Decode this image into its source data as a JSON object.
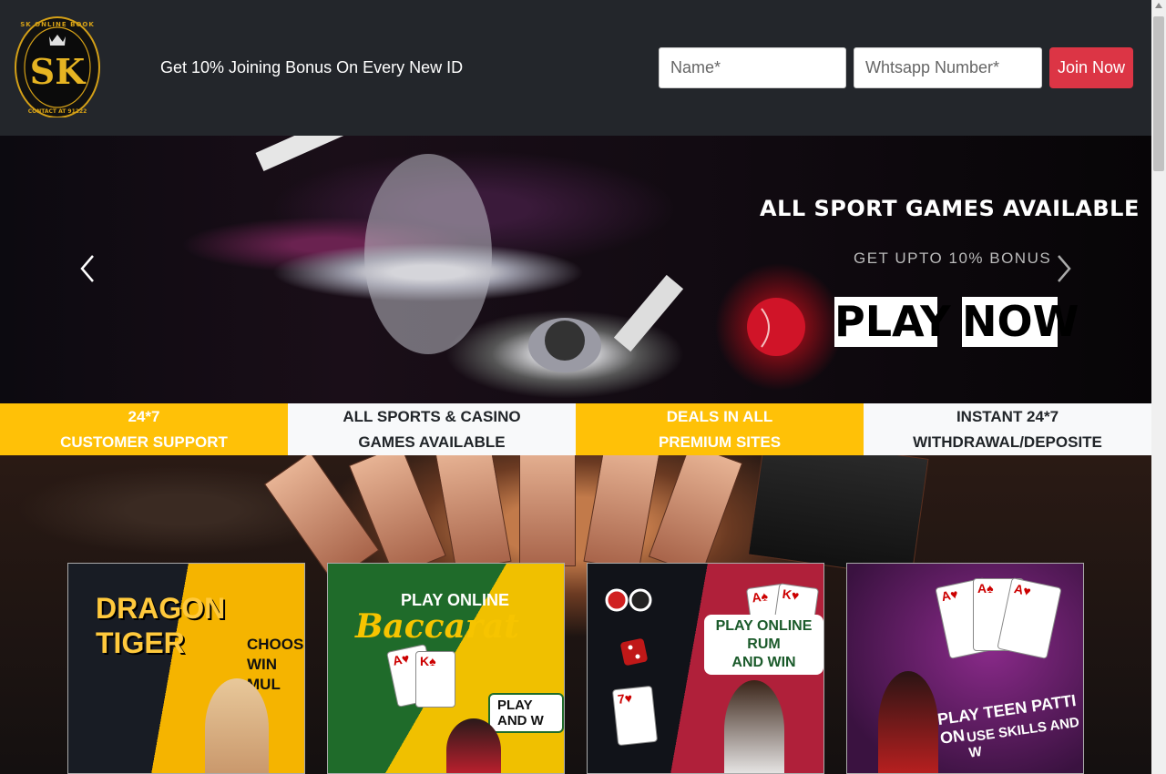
{
  "header": {
    "logo_monogram": "SK",
    "logo_ring_text": "SK ONLINE BOOK · CONTACT AT 91222",
    "tagline": "Get 10% Joining Bonus On Every New ID",
    "name_placeholder": "Name*",
    "whatsapp_placeholder": "Whtsapp Number*",
    "join_label": "Join Now"
  },
  "hero": {
    "title": "ALL SPORT GAMES AVAILABLE",
    "subtitle": "GET UPTO 10% BONUS",
    "play_word": "PLAY",
    "now_word": "NOW",
    "prev_icon": "chevron-left-icon",
    "next_icon": "chevron-right-icon"
  },
  "features": [
    {
      "line1": "24*7",
      "line2": "CUSTOMER SUPPORT",
      "style": "yellow"
    },
    {
      "line1": "ALL SPORTS & CASINO",
      "line2": "GAMES AVAILABLE",
      "style": "light"
    },
    {
      "line1": "DEALS IN ALL",
      "line2": "PREMIUM SITES",
      "style": "yellow"
    },
    {
      "line1": "INSTANT 24*7",
      "line2": "WITHDRAWAL/DEPOSITE",
      "style": "light"
    }
  ],
  "games": [
    {
      "title_1": "DRAGON",
      "title_2": "TIGER",
      "side_1": "CHOOSE",
      "side_2": "WIN MUL"
    },
    {
      "title": "PLAY ONLINE",
      "script": "Baccarat",
      "cta": "PLAY AND W"
    },
    {
      "title_1": "PLAY ONLINE RUM",
      "title_2": "AND WIN"
    },
    {
      "title": "PLAY TEEN PATTI ON",
      "sub": "USE SKILLS AND W"
    }
  ],
  "colors": {
    "header_bg": "#23262b",
    "join_button": "#dc3545",
    "feature_yellow": "#ffc107",
    "feature_light": "#f8f9fa",
    "logo_gold": "#d4a017"
  }
}
